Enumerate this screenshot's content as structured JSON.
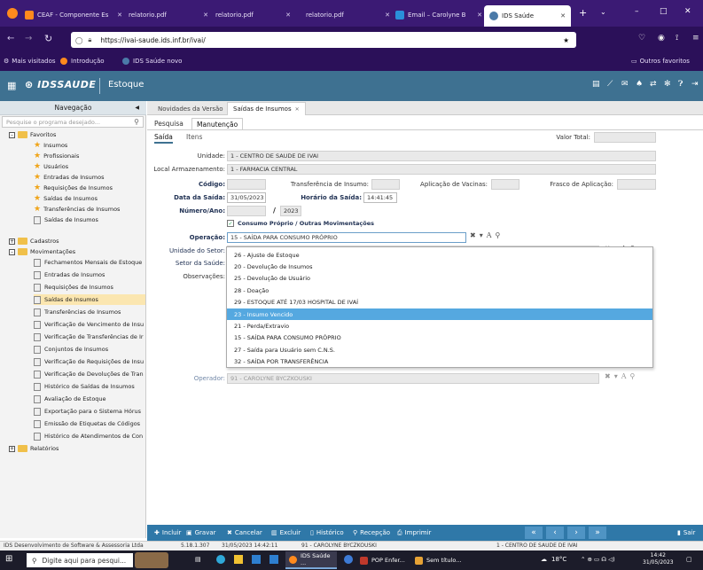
{
  "browser": {
    "tabs": [
      {
        "label": "CEAF - Componente Es",
        "icon": "mozilla-icon"
      },
      {
        "label": "relatorio.pdf"
      },
      {
        "label": "relatorio.pdf"
      },
      {
        "label": "relatorio.pdf"
      },
      {
        "label": "Email – Carolyne B"
      },
      {
        "label": "IDS Saúde"
      }
    ],
    "url": "https://ivai-saude.ids.inf.br/ivai/",
    "bookmarks": [
      "Mais visitados",
      "Introdução",
      "IDS Saúde novo"
    ],
    "other_bookmarks": "Outros favoritos"
  },
  "app": {
    "logo_text": "IDSSAUDE",
    "module": "Estoque"
  },
  "sidebar": {
    "title": "Navegação",
    "search_placeholder": "Pesquise o programa desejado...",
    "favoritos": "Favoritos",
    "fav_items": [
      "Insumos",
      "Profissionais",
      "Usuários",
      "Entradas de Insumos",
      "Requisições de Insumos",
      "Saídas de Insumos",
      "Transferências de Insumos",
      "Saídas de Insumos"
    ],
    "cadastros": "Cadastros",
    "movimentacoes": "Movimentações",
    "mov_items": [
      "Fechamentos Mensais de Estoque",
      "Entradas de Insumos",
      "Requisições de Insumos",
      "Saídas de Insumos",
      "Transferências de Insumos",
      "Verificação de Vencimento de Insu",
      "Verificação de Transferências de Ir",
      "Conjuntos de Insumos",
      "Verificação de Requisições de Insu",
      "Verificação de Devoluções de Tran",
      "Histórico de Saídas de Insumos",
      "Avaliação de Estoque",
      "Exportação para o Sistema Hórus",
      "Emissão de Etiquetas de Códigos",
      "Histórico de Atendimentos de Con"
    ],
    "relatorios": "Relatórios"
  },
  "main": {
    "tabs": [
      "Novidades da Versão",
      "Saídas de Insumos"
    ],
    "subtabs": [
      "Pesquisa",
      "Manutenção"
    ],
    "inner_tabs": [
      "Saída",
      "Itens"
    ],
    "valor_total_label": "Valor Total:",
    "unidade_label": "Unidade:",
    "unidade_value": "1 - CENTRO DE SAUDE DE IVAI",
    "local_label": "Local Armazenamento:",
    "local_value": "1 - FARMACIA CENTRAL",
    "codigo_label": "Código:",
    "transferencia_label": "Transferência de Insumo:",
    "aplicacao_label": "Aplicação de Vacinas:",
    "frasco_label": "Frasco de Aplicação:",
    "data_label": "Data da Saída:",
    "data_value": "31/05/2023",
    "horario_label": "Horário da Saída:",
    "horario_value": "14:41:45",
    "numero_label": "Número/Ano:",
    "ano_value": "2023",
    "consumo_label": "Consumo Próprio / Outras Movimentações",
    "operacao_label": "Operação:",
    "operacao_value": "15 - SAÍDA PARA CONSUMO PRÓPRIO",
    "unidade_setor_label": "Unidade do Setor:",
    "setor_label": "Setor da Saúde:",
    "observacoes_label": "Observações:",
    "operador_label": "Operador:",
    "operador_value": "91 - CAROLYNE BYCZKOUSKI"
  },
  "dropdown": {
    "options": [
      "26 - Ajuste de Estoque",
      "20 - Devolução de Insumos",
      "25 - Devolução de Usuário",
      "28 - Doação",
      "29 - ESTOQUE ATÉ 17/03 HOSPITAL DE IVAÍ",
      "23 - Insumo Vencido",
      "21 - Perda/Extravio",
      "15 - SAÍDA PARA CONSUMO PRÓPRIO",
      "27 - Saída para Usuário sem C.N.S.",
      "32 - SAÍDA POR TRANSFERÊNCIA"
    ],
    "highlighted_index": 5
  },
  "toolbar": {
    "incluir": "Incluir",
    "gravar": "Gravar",
    "cancelar": "Cancelar",
    "excluir": "Excluir",
    "historico": "Histórico",
    "recepcao": "Recepção",
    "imprimir": "Imprimir",
    "sair": "Sair"
  },
  "status": {
    "company": "IDS Desenvolvimento de Software & Assessoria Ltda",
    "version": "5.18.1.307",
    "datetime": "31/05/2023 14:42:11",
    "user": "91 - CAROLYNE BYCZKOUSKI",
    "unit": "1 - CENTRO DE SAUDE DE IVAI"
  },
  "taskbar": {
    "search": "Digite aqui para pesqui...",
    "apps": [
      "IDS Saúde ...",
      "POP Enfer...",
      "Sem título..."
    ],
    "temp": "18°C",
    "time": "14:42",
    "date": "31/05/2023"
  },
  "colors": {
    "header": "#3e7191",
    "highlight": "#55a8e0",
    "toolbar": "#2f78a8",
    "browser": "#3b1a74"
  }
}
